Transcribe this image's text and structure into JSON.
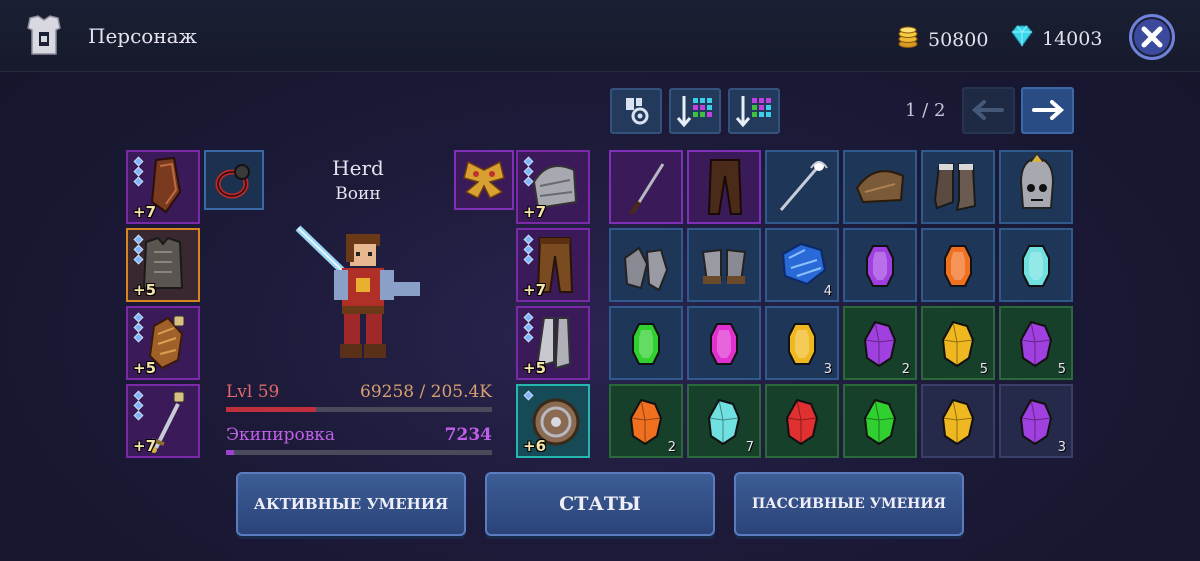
{
  "header": {
    "title": "Персонаж",
    "gold": "50800",
    "gems": "14003"
  },
  "pagination": {
    "page": "1 / 2"
  },
  "hero": {
    "name": "Herd",
    "class": "Воин",
    "level_label": "Lvl 59",
    "xp_label": "69258 / 205.4K",
    "xp_fraction": 0.34,
    "equipment_label": "Экипировка",
    "equipment_score": "7234",
    "equipment_fraction": 0.03
  },
  "equipment": {
    "left": [
      {
        "item": "bracers-icon",
        "plus": "+7",
        "gems": 3
      },
      {
        "item": "chest-armor-icon",
        "plus": "+5",
        "gems": 3
      },
      {
        "item": "gauntlets-icon",
        "plus": "+5",
        "gems": 3
      },
      {
        "item": "sword-icon",
        "plus": "+7",
        "gems": 3
      }
    ],
    "right": [
      {
        "item": "shoulder-armor-icon",
        "plus": "+7",
        "gems": 3
      },
      {
        "item": "pants-icon",
        "plus": "+7",
        "gems": 3
      },
      {
        "item": "boots-icon",
        "plus": "+5",
        "gems": 3
      },
      {
        "item": "shield-icon",
        "plus": "+6",
        "gems": 1
      }
    ],
    "ring": "ring-icon",
    "amulet": "butterfly-amulet-icon"
  },
  "inventory": [
    {
      "item": "katana-icon",
      "color": "purple",
      "count": ""
    },
    {
      "item": "pants-icon",
      "color": "purple",
      "count": ""
    },
    {
      "item": "staff-icon",
      "color": "blue",
      "count": ""
    },
    {
      "item": "shoulder-armor-icon",
      "color": "blue",
      "count": ""
    },
    {
      "item": "boots-icon",
      "color": "blue",
      "count": ""
    },
    {
      "item": "skull-helmet-icon",
      "color": "blue",
      "count": ""
    },
    {
      "item": "gauntlets-icon",
      "color": "blue",
      "count": ""
    },
    {
      "item": "gloves-icon",
      "color": "blue",
      "count": ""
    },
    {
      "item": "blue-crystal-icon",
      "color": "blue",
      "count": "4"
    },
    {
      "item": "purple-gem-icon",
      "color": "blue",
      "count": ""
    },
    {
      "item": "orange-gem-icon",
      "color": "blue",
      "count": ""
    },
    {
      "item": "cyan-gem-icon",
      "color": "blue",
      "count": ""
    },
    {
      "item": "green-gem-icon",
      "color": "blue",
      "count": ""
    },
    {
      "item": "magenta-gem-icon",
      "color": "blue",
      "count": ""
    },
    {
      "item": "yellow-gem-icon",
      "color": "blue",
      "count": "3"
    },
    {
      "item": "purple-rough-gem-icon",
      "color": "green",
      "count": "2"
    },
    {
      "item": "yellow-rough-gem-icon",
      "color": "green",
      "count": "5"
    },
    {
      "item": "purple-rough-gem-icon",
      "color": "green",
      "count": "5"
    },
    {
      "item": "orange-rough-gem-icon",
      "color": "green",
      "count": "2"
    },
    {
      "item": "cyan-rough-gem-icon",
      "color": "green",
      "count": "7"
    },
    {
      "item": "red-rough-gem-icon",
      "color": "green",
      "count": ""
    },
    {
      "item": "green-rough-gem-icon",
      "color": "green",
      "count": ""
    },
    {
      "item": "yellow-rough-gem-icon",
      "color": "navy",
      "count": ""
    },
    {
      "item": "purple-rough-gem-icon",
      "color": "navy",
      "count": "3"
    }
  ],
  "buttons": {
    "active_skills": "АКТИВНЫЕ УМЕНИЯ",
    "stats": "СТАТЫ",
    "passive_skills": "ПАССИВНЫЕ УМЕНИЯ"
  },
  "colors": {
    "xp_bar": "#c0303c",
    "equipment_bar": "#a040d0",
    "level_text": "#e06a6a",
    "equipment_text": "#c060e8"
  }
}
